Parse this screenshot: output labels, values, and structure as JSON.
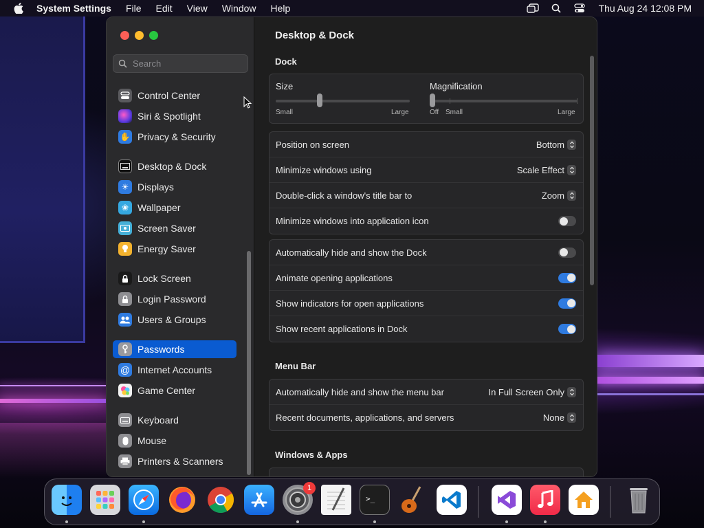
{
  "menubar": {
    "app_name": "System Settings",
    "items": [
      "File",
      "Edit",
      "View",
      "Window",
      "Help"
    ],
    "clock": "Thu Aug 24  12:08 PM"
  },
  "sidebar": {
    "search_placeholder": "Search",
    "items": [
      {
        "label": "Control Center",
        "icon": "control-center-icon",
        "color": "#5a5a5e"
      },
      {
        "label": "Siri & Spotlight",
        "icon": "siri-icon",
        "color": "#8a3ad8"
      },
      {
        "label": "Privacy & Security",
        "icon": "hand-icon",
        "color": "#2f7be0"
      },
      {
        "label": "Desktop & Dock",
        "icon": "desktop-dock-icon",
        "color": "#3a3a3c"
      },
      {
        "label": "Displays",
        "icon": "sun-icon",
        "color": "#2f7be0"
      },
      {
        "label": "Wallpaper",
        "icon": "flower-icon",
        "color": "#35a8e0"
      },
      {
        "label": "Screen Saver",
        "icon": "screen-saver-icon",
        "color": "#45b0d8"
      },
      {
        "label": "Energy Saver",
        "icon": "bulb-icon",
        "color": "#f3b22e"
      },
      {
        "label": "Lock Screen",
        "icon": "lock-icon",
        "color": "#2a2a2c"
      },
      {
        "label": "Login Password",
        "icon": "lock-icon",
        "color": "#8e8e92"
      },
      {
        "label": "Users & Groups",
        "icon": "users-icon",
        "color": "#2f7be0"
      },
      {
        "label": "Passwords",
        "icon": "key-icon",
        "color": "#8e8e92"
      },
      {
        "label": "Internet Accounts",
        "icon": "at-icon",
        "color": "#2f7be0"
      },
      {
        "label": "Game Center",
        "icon": "game-center-icon",
        "color": "#e0e0e0"
      },
      {
        "label": "Keyboard",
        "icon": "keyboard-icon",
        "color": "#8e8e92"
      },
      {
        "label": "Mouse",
        "icon": "mouse-icon",
        "color": "#8e8e92"
      },
      {
        "label": "Printers & Scanners",
        "icon": "printer-icon",
        "color": "#8e8e92"
      }
    ],
    "selected": "Passwords"
  },
  "main": {
    "title": "Desktop & Dock",
    "dock_section": "Dock",
    "size": {
      "label": "Size",
      "min": "Small",
      "max": "Large",
      "value": 0.33
    },
    "magnification": {
      "label": "Magnification",
      "off": "Off",
      "min": "Small",
      "max": "Large",
      "value": 0.0
    },
    "group1": [
      {
        "label": "Position on screen",
        "value": "Bottom"
      },
      {
        "label": "Minimize windows using",
        "value": "Scale Effect"
      },
      {
        "label": "Double-click a window's title bar to",
        "value": "Zoom"
      },
      {
        "label": "Minimize windows into application icon",
        "toggle": false
      }
    ],
    "group2": [
      {
        "label": "Automatically hide and show the Dock",
        "toggle": false
      },
      {
        "label": "Animate opening applications",
        "toggle": true
      },
      {
        "label": "Show indicators for open applications",
        "toggle": true
      },
      {
        "label": "Show recent applications in Dock",
        "toggle": true
      }
    ],
    "menubar_section": "Menu Bar",
    "group3": [
      {
        "label": "Automatically hide and show the menu bar",
        "value": "In Full Screen Only"
      },
      {
        "label": "Recent documents, applications, and servers",
        "value": "None"
      }
    ],
    "windows_section": "Windows & Apps"
  },
  "dock": {
    "apps": [
      {
        "name": "finder-icon",
        "color": "#1e90ff"
      },
      {
        "name": "launchpad-icon",
        "color": "#d8d8dc"
      },
      {
        "name": "safari-icon",
        "color": "#1a8cff"
      },
      {
        "name": "firefox-icon",
        "color": "#ff7139"
      },
      {
        "name": "chrome-icon",
        "color": "#ffffff"
      },
      {
        "name": "app-store-icon",
        "color": "#1c8cf5"
      },
      {
        "name": "system-settings-icon",
        "color": "#8e8e92",
        "badge": "1"
      },
      {
        "name": "textedit-icon",
        "color": "#f4f4f4"
      },
      {
        "name": "terminal-icon",
        "color": "#1e1e1e"
      },
      {
        "name": "guitar-icon",
        "color": "#3a2a1e"
      },
      {
        "name": "vscode-icon",
        "color": "#ffffff"
      },
      {
        "name": "visual-studio-icon",
        "color": "#ffffff"
      },
      {
        "name": "music-icon",
        "color": "#fa2d48"
      },
      {
        "name": "home-icon",
        "color": "#ffffff"
      },
      {
        "name": "trash-icon",
        "color": "#8e8e92"
      }
    ]
  }
}
